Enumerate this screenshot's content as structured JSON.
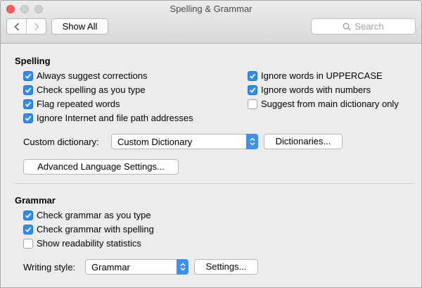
{
  "window": {
    "title": "Spelling & Grammar"
  },
  "toolbar": {
    "show_all_label": "Show All",
    "search_placeholder": "Search"
  },
  "spelling": {
    "title": "Spelling",
    "left_options": [
      {
        "label": "Always suggest corrections",
        "checked": true
      },
      {
        "label": "Check spelling as you type",
        "checked": true
      },
      {
        "label": "Flag repeated words",
        "checked": true
      },
      {
        "label": "Ignore Internet and file path addresses",
        "checked": true
      }
    ],
    "right_options": [
      {
        "label": "Ignore words in UPPERCASE",
        "checked": true
      },
      {
        "label": "Ignore words with numbers",
        "checked": true
      },
      {
        "label": "Suggest from main dictionary only",
        "checked": false
      }
    ],
    "custom_dictionary_label": "Custom dictionary:",
    "custom_dictionary_value": "Custom Dictionary",
    "dictionaries_button": "Dictionaries...",
    "advanced_button": "Advanced Language Settings..."
  },
  "grammar": {
    "title": "Grammar",
    "options": [
      {
        "label": "Check grammar as you type",
        "checked": true
      },
      {
        "label": "Check grammar with spelling",
        "checked": true
      },
      {
        "label": "Show readability statistics",
        "checked": false
      }
    ],
    "writing_style_label": "Writing style:",
    "writing_style_value": "Grammar",
    "settings_button": "Settings..."
  },
  "colors": {
    "accent": "#2f8bf5",
    "close": "#fc605c"
  }
}
